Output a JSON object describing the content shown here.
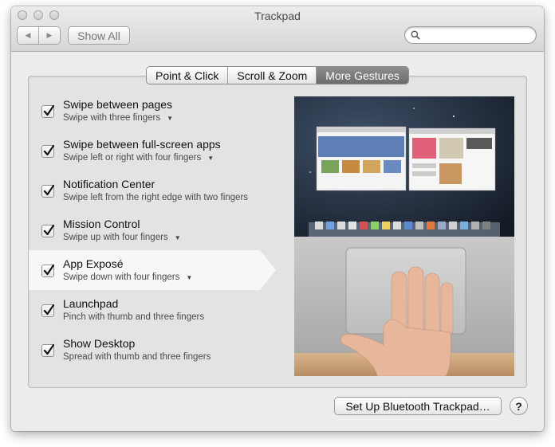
{
  "window": {
    "title": "Trackpad"
  },
  "toolbar": {
    "back_icon": "◀",
    "forward_icon": "▶",
    "show_all_label": "Show All",
    "search_placeholder": ""
  },
  "tabs": [
    {
      "label": "Point & Click",
      "active": false
    },
    {
      "label": "Scroll & Zoom",
      "active": false
    },
    {
      "label": "More Gestures",
      "active": true
    }
  ],
  "gestures": [
    {
      "title": "Swipe between pages",
      "subtitle": "Swipe with three fingers",
      "has_dropdown": true,
      "checked": true
    },
    {
      "title": "Swipe between full-screen apps",
      "subtitle": "Swipe left or right with four fingers",
      "has_dropdown": true,
      "checked": true
    },
    {
      "title": "Notification Center",
      "subtitle": "Swipe left from the right edge with two fingers",
      "has_dropdown": false,
      "checked": true
    },
    {
      "title": "Mission Control",
      "subtitle": "Swipe up with four fingers",
      "has_dropdown": true,
      "checked": true
    },
    {
      "title": "App Exposé",
      "subtitle": "Swipe down with four fingers",
      "has_dropdown": true,
      "checked": true,
      "selected": true
    },
    {
      "title": "Launchpad",
      "subtitle": "Pinch with thumb and three fingers",
      "has_dropdown": false,
      "checked": true
    },
    {
      "title": "Show Desktop",
      "subtitle": "Spread with thumb and three fingers",
      "has_dropdown": false,
      "checked": true
    }
  ],
  "dropdown_arrow": "▼",
  "footer": {
    "bluetooth_button": "Set Up Bluetooth Trackpad…",
    "help_label": "?"
  },
  "colors": {
    "selected_tab": "#7a7a7a",
    "panel_bg": "#e3e3e3",
    "selected_row": "#f7f7f7"
  }
}
